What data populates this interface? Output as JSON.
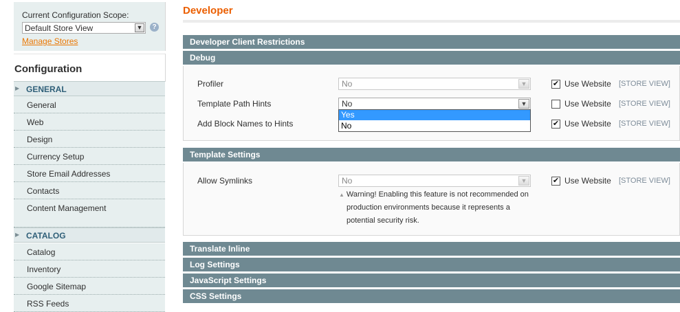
{
  "sidebar": {
    "scope_label": "Current Configuration Scope:",
    "scope_value": "Default Store View",
    "manage_stores": "Manage Stores",
    "title": "Configuration",
    "sections": [
      {
        "label": "GENERAL",
        "items": [
          "General",
          "Web",
          "Design",
          "Currency Setup",
          "Store Email Addresses",
          "Contacts",
          "Content Management"
        ]
      },
      {
        "label": "CATALOG",
        "items": [
          "Catalog",
          "Inventory",
          "Google Sitemap",
          "RSS Feeds"
        ]
      }
    ]
  },
  "main": {
    "title": "Developer",
    "sections": {
      "client_restrictions": "Developer Client Restrictions",
      "debug": "Debug",
      "template_settings": "Template Settings",
      "translate_inline": "Translate Inline",
      "log_settings": "Log Settings",
      "javascript_settings": "JavaScript Settings",
      "css_settings": "CSS Settings"
    },
    "debug_fields": [
      {
        "label": "Profiler",
        "value": "No",
        "use_website": "Use Website",
        "scope": "[STORE VIEW]",
        "checked": true
      },
      {
        "label": "Template Path Hints",
        "value": "No",
        "use_website": "Use Website",
        "scope": "[STORE VIEW]",
        "checked": false
      },
      {
        "label": "Add Block Names to Hints",
        "value": "No",
        "use_website": "Use Website",
        "scope": "[STORE VIEW]",
        "checked": true
      }
    ],
    "dropdown_options": [
      "Yes",
      "No"
    ],
    "template_fields": [
      {
        "label": "Allow Symlinks",
        "value": "No",
        "use_website": "Use Website",
        "scope": "[STORE VIEW]",
        "checked": true
      }
    ],
    "warning_lines": [
      "Warning! Enabling this feature is not recommended on",
      "production environments because it represents a",
      "potential security risk."
    ]
  },
  "icons": {
    "check": "✔",
    "arrow": "▼",
    "help": "?",
    "triangle": "▶",
    "warn": "▲"
  },
  "colors": {
    "accent": "#eb5e00",
    "link": "#ea7601",
    "section_header": "#6f8992",
    "nav_label": "#2f5f78",
    "highlight": "#3399ff"
  }
}
